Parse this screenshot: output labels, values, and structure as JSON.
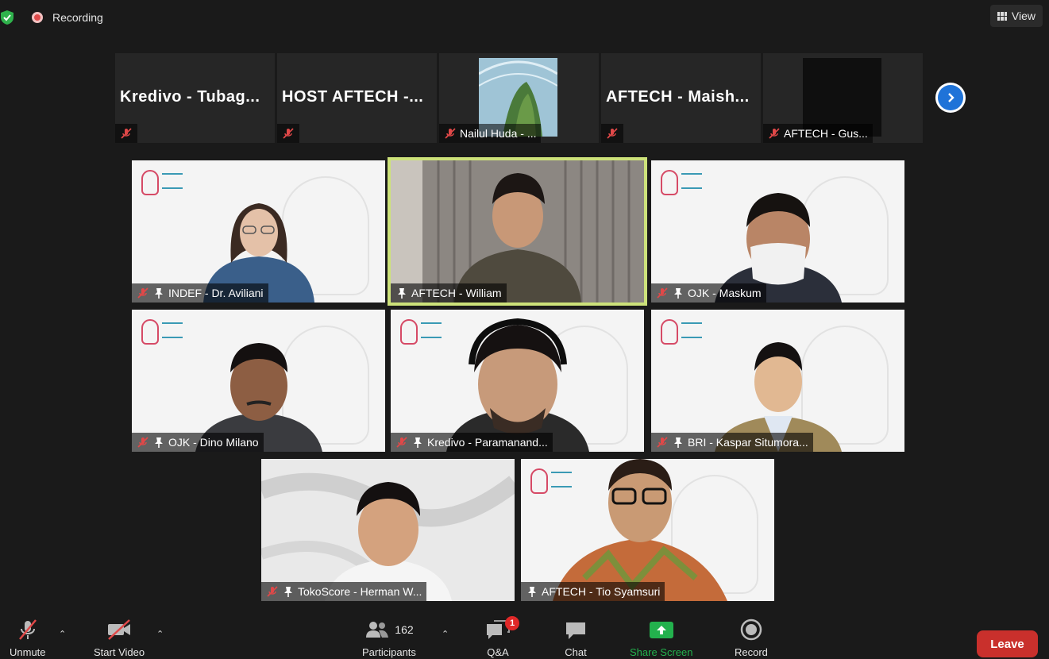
{
  "topbar": {
    "recording_label": "Recording",
    "view_label": "View"
  },
  "strip": {
    "thumbnails": [
      {
        "name_big": "Kredivo - Tubag...",
        "footer": ""
      },
      {
        "name_big": "HOST AFTECH -...",
        "footer": ""
      },
      {
        "name_big": "",
        "footer": "Nailul Huda - ..."
      },
      {
        "name_big": "AFTECH - Maish...",
        "footer": ""
      },
      {
        "name_big": "",
        "footer": "AFTECH - Gus..."
      }
    ]
  },
  "tiles": [
    {
      "label": "INDEF - Dr. Aviliani",
      "muted": true,
      "pinned": true,
      "active": false
    },
    {
      "label": "AFTECH - William",
      "muted": false,
      "pinned": true,
      "active": true
    },
    {
      "label": "OJK - Maskum",
      "muted": true,
      "pinned": true,
      "active": false
    },
    {
      "label": "OJK - Dino Milano",
      "muted": true,
      "pinned": true,
      "active": false
    },
    {
      "label": "Kredivo - Paramanand...",
      "muted": true,
      "pinned": true,
      "active": false
    },
    {
      "label": "BRI - Kaspar Situmora...",
      "muted": true,
      "pinned": true,
      "active": false
    },
    {
      "label": "TokoScore - Herman W...",
      "muted": true,
      "pinned": true,
      "active": false
    },
    {
      "label": "AFTECH - Tio Syamsuri",
      "muted": false,
      "pinned": true,
      "active": false
    }
  ],
  "toolbar": {
    "unmute_label": "Unmute",
    "start_video_label": "Start Video",
    "participants_label": "Participants",
    "participants_count": "162",
    "qa_label": "Q&A",
    "qa_badge": "1",
    "chat_label": "Chat",
    "share_label": "Share Screen",
    "record_label": "Record",
    "leave_label": "Leave"
  },
  "colors": {
    "background": "#1a1a1a",
    "active_speaker": "#cde27a",
    "share_green": "#23b14d",
    "leave_red": "#c9302c",
    "muted_red": "#e04848",
    "next_blue": "#1f73d8"
  }
}
